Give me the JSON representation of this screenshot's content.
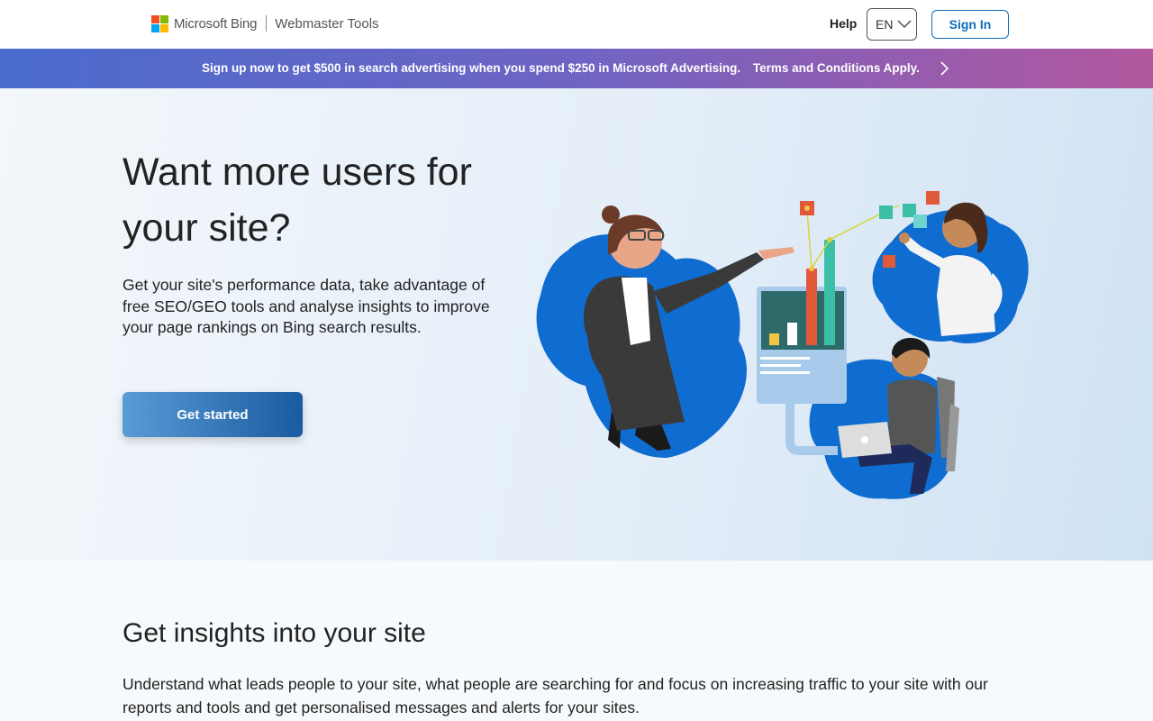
{
  "header": {
    "brand": "Microsoft Bing",
    "product": "Webmaster Tools",
    "help_label": "Help",
    "language": "EN",
    "signin_label": "Sign In"
  },
  "banner": {
    "text": "Sign up now to get $500 in search advertising when you spend $250 in Microsoft Advertising.",
    "terms": "Terms and Conditions Apply."
  },
  "hero": {
    "title": "Want more users for your site?",
    "description": "Get your site's performance data, take advantage of free SEO/GEO tools and analyse insights to improve your page rankings on Bing search results.",
    "cta_label": "Get started"
  },
  "insights": {
    "title": "Get insights into your site",
    "description": "Understand what leads people to your site, what people are searching for and focus on increasing traffic to your site with our reports and tools and get personalised messages and alerts for your sites."
  },
  "colors": {
    "accent": "#0f6cbd",
    "ms_red": "#f25022",
    "ms_green": "#7fba00",
    "ms_blue": "#00a4ef",
    "ms_yellow": "#ffb900"
  }
}
